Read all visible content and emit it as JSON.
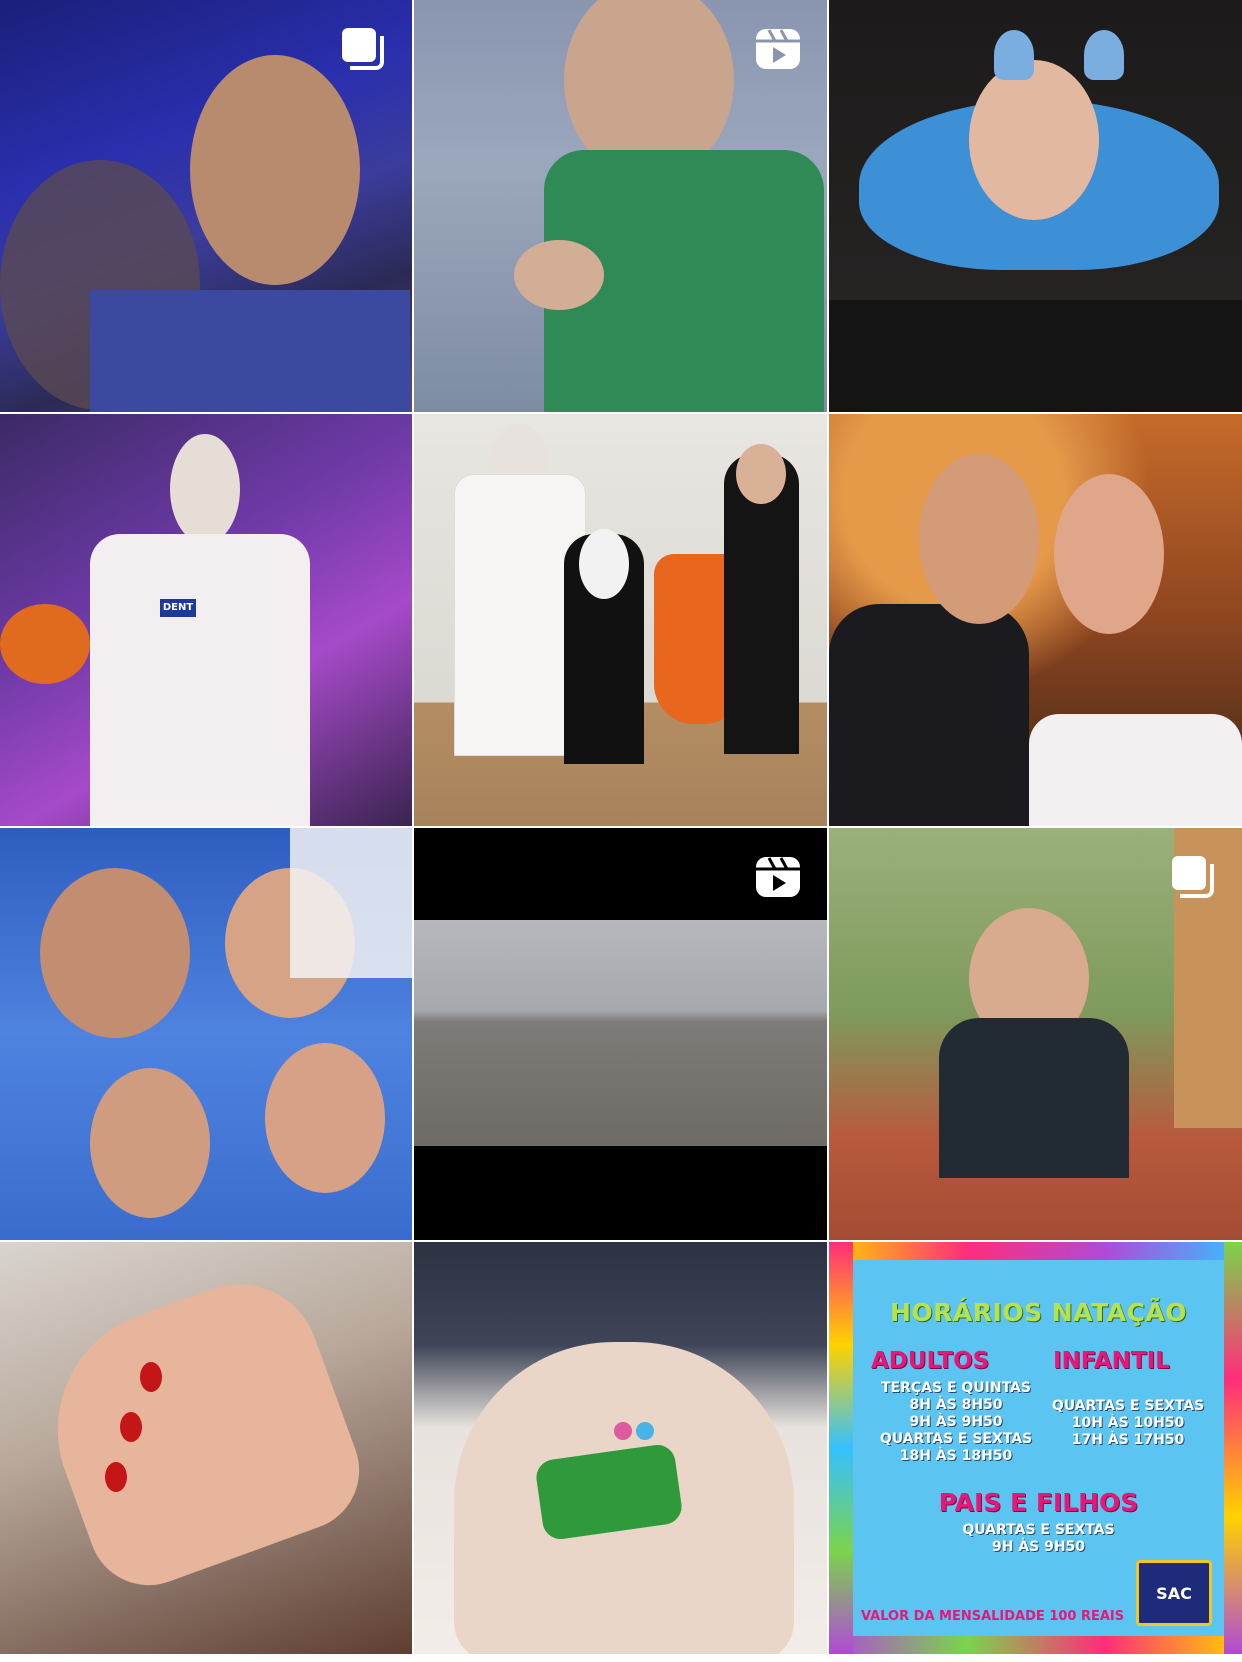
{
  "grid": {
    "tiles": [
      {
        "id": 1,
        "badge": "carousel-icon"
      },
      {
        "id": 2,
        "badge": "reels-icon"
      },
      {
        "id": 3,
        "badge": ""
      },
      {
        "id": 4,
        "badge": ""
      },
      {
        "id": 5,
        "badge": ""
      },
      {
        "id": 6,
        "badge": ""
      },
      {
        "id": 7,
        "badge": ""
      },
      {
        "id": 8,
        "badge": "reels-icon"
      },
      {
        "id": 9,
        "badge": "carousel-icon"
      },
      {
        "id": 10,
        "badge": ""
      },
      {
        "id": 11,
        "badge": ""
      },
      {
        "id": 12,
        "badge": ""
      }
    ]
  },
  "poster": {
    "title": "HORÁRIOS NATAÇÃO",
    "adultos_heading": "ADULTOS",
    "adultos_text": "TERÇAS E QUINTAS\n8H ÀS 8H50\n9H ÀS 9H50\nQUARTAS E SEXTAS\n18H ÀS 18H50",
    "infantil_heading": "INFANTIL",
    "infantil_text": "QUARTAS E SEXTAS\n10H ÀS 10H50\n17H ÀS 17H50",
    "pais_heading": "PAIS E FILHOS",
    "pais_text": "QUARTAS E SEXTAS\n9H ÀS 9H50",
    "footer": "VALOR DA MENSALIDADE 100 REAIS",
    "logo_text": "SAC"
  },
  "photo_texts": {
    "costume_badge": "DENT"
  }
}
